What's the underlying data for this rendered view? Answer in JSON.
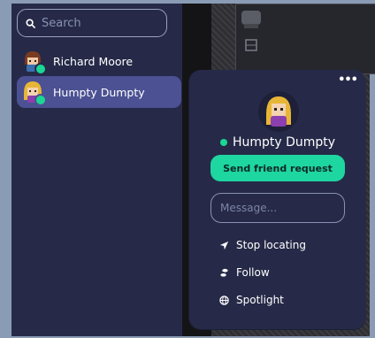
{
  "search": {
    "placeholder": "Search"
  },
  "users": [
    {
      "name": "Richard Moore",
      "status": "online"
    },
    {
      "name": "Humpty Dumpty",
      "status": "online",
      "selected": true
    }
  ],
  "profile_card": {
    "more_label": "•••",
    "name": "Humpty Dumpty",
    "status": "online",
    "friend_button": "Send friend request",
    "message_placeholder": "Message...",
    "actions": [
      {
        "label": "Stop locating",
        "icon": "location-arrow-icon"
      },
      {
        "label": "Follow",
        "icon": "footsteps-icon"
      },
      {
        "label": "Spotlight",
        "icon": "globe-icon"
      }
    ]
  },
  "colors": {
    "online": "#1bd694",
    "accent": "#1ed6a0",
    "selected_row": "#4b5192",
    "panel": "#262a48"
  }
}
